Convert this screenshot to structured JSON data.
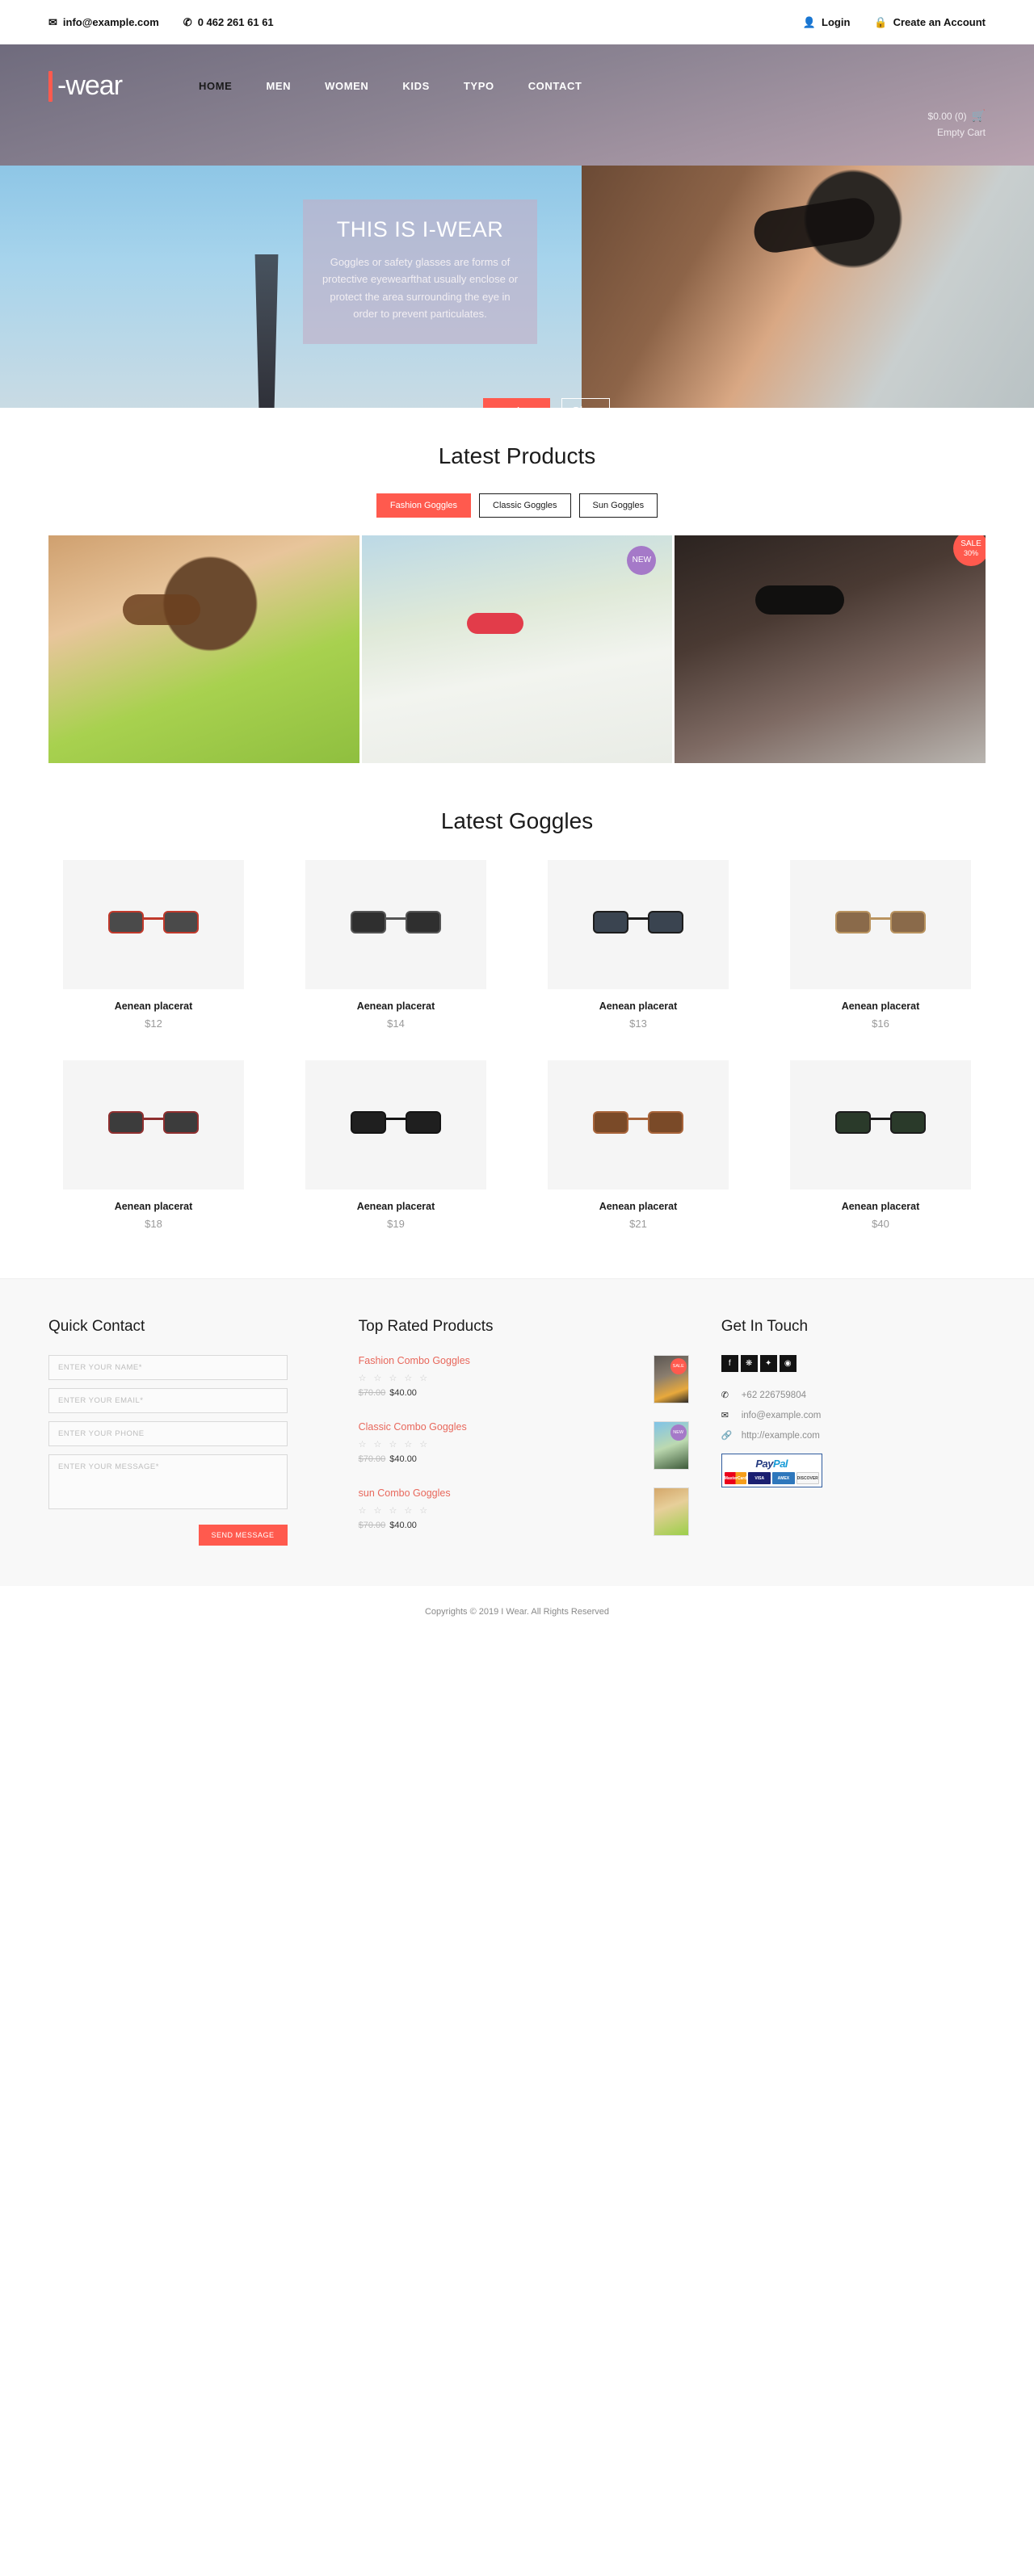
{
  "topbar": {
    "email": "info@example.com",
    "phone": "0 462 261 61 61",
    "login": "Login",
    "create_account": "Create an Account",
    "icons": {
      "mail": "✉",
      "phone": "✆",
      "user": "👤",
      "lock": "🔒"
    }
  },
  "header": {
    "logo_text": "-wear",
    "nav": [
      {
        "label": "HOME",
        "active": true
      },
      {
        "label": "MEN",
        "active": false
      },
      {
        "label": "WOMEN",
        "active": false
      },
      {
        "label": "KIDS",
        "active": false
      },
      {
        "label": "TYPO",
        "active": false
      },
      {
        "label": "CONTACT",
        "active": false
      }
    ],
    "cart_total": "$0.00 (0)",
    "cart_status": "Empty Cart"
  },
  "hero": {
    "title": "THIS IS I-WEAR",
    "description": "Goggles or safety glasses are forms of protective eyewearfthat usually enclose or protect the area surrounding the eye in order to prevent particulates.",
    "btn_explore": "Explore",
    "btn_shop": "Shop Now"
  },
  "latest_products": {
    "title": "Latest Products",
    "tabs": [
      {
        "label": "Fashion Goggles",
        "active": true
      },
      {
        "label": "Classic Goggles",
        "active": false
      },
      {
        "label": "Sun Goggles",
        "active": false
      }
    ],
    "badges": {
      "new": "NEW",
      "sale": "SALE",
      "sale_pct": "30%"
    }
  },
  "latest_goggles": {
    "title": "Latest Goggles",
    "items": [
      {
        "name": "Aenean placerat",
        "price": "$12",
        "lens": "#4a4a4a",
        "frame": "#c0392b"
      },
      {
        "name": "Aenean placerat",
        "price": "$14",
        "lens": "#2f2f2f",
        "frame": "#555555"
      },
      {
        "name": "Aenean placerat",
        "price": "$13",
        "lens": "#3a4450",
        "frame": "#1d1d1d"
      },
      {
        "name": "Aenean placerat",
        "price": "$16",
        "lens": "#8a6a4a",
        "frame": "#b9935f"
      },
      {
        "name": "Aenean placerat",
        "price": "$18",
        "lens": "#3c3c3c",
        "frame": "#8e2f2f"
      },
      {
        "name": "Aenean placerat",
        "price": "$19",
        "lens": "#1f1f1f",
        "frame": "#141414"
      },
      {
        "name": "Aenean placerat",
        "price": "$21",
        "lens": "#7a4a28",
        "frame": "#a8643a"
      },
      {
        "name": "Aenean placerat",
        "price": "$40",
        "lens": "#2a3a2a",
        "frame": "#1c1c1c"
      }
    ]
  },
  "footer": {
    "quick_contact": {
      "title": "Quick Contact",
      "name_placeholder": "Enter Your Name*",
      "email_placeholder": "Enter Your Email*",
      "phone_placeholder": "Enter Your Phone",
      "message_placeholder": "Enter Your Message*",
      "send_label": "SEND MESSAGE"
    },
    "top_rated": {
      "title": "Top Rated Products",
      "items": [
        {
          "name": "Fashion Combo Goggles",
          "stars": "☆ ☆ ☆ ☆ ☆",
          "old_price": "$70.00",
          "price": "$40.00",
          "badge": "SALE"
        },
        {
          "name": "Classic Combo Goggles",
          "stars": "☆ ☆ ☆ ☆ ☆",
          "old_price": "$70.00",
          "price": "$40.00",
          "badge": "NEW"
        },
        {
          "name": "sun Combo Goggles",
          "stars": "☆ ☆ ☆ ☆ ☆",
          "old_price": "$70.00",
          "price": "$40.00",
          "badge": ""
        }
      ]
    },
    "get_in_touch": {
      "title": "Get In Touch",
      "socials": [
        {
          "name": "facebook",
          "glyph": "f"
        },
        {
          "name": "rss",
          "glyph": "❋"
        },
        {
          "name": "twitter",
          "glyph": "✦"
        },
        {
          "name": "dribbble",
          "glyph": "◉"
        }
      ],
      "phone": "+62 226759804",
      "email": "info@example.com",
      "website": "http://example.com",
      "paypal": {
        "pay": "Pay",
        "pal": "Pal"
      },
      "cards": [
        "MasterCard",
        "VISA",
        "AMEX",
        "DISCOVER"
      ]
    }
  },
  "copyright": "Copyrights © 2019 I Wear. All Rights Reserved",
  "colors": {
    "accent": "#FF5A4E",
    "new_badge": "#A579C8",
    "link": "#E8685C"
  }
}
